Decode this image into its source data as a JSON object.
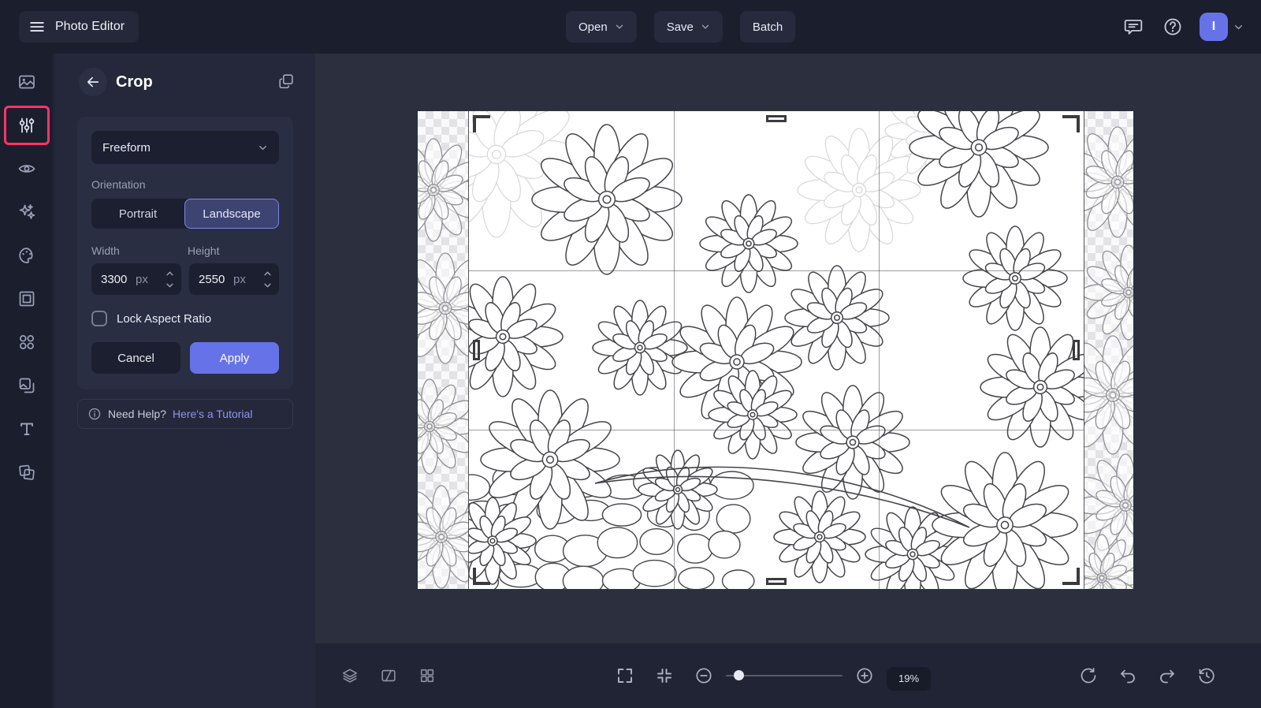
{
  "app": {
    "title": "Photo Editor"
  },
  "topbar": {
    "open": "Open",
    "save": "Save",
    "batch": "Batch",
    "icons": [
      "hamburger-icon",
      "chevron-down-icon",
      "feedback-icon",
      "help-icon"
    ],
    "avatar_initial": "I"
  },
  "sidebar": {
    "items": [
      {
        "id": "photo",
        "icon": "photo-icon",
        "selected": false
      },
      {
        "id": "edit",
        "icon": "sliders-icon",
        "selected": true,
        "highlighted": true
      },
      {
        "id": "touchup",
        "icon": "eye-icon",
        "selected": false
      },
      {
        "id": "effects",
        "icon": "sparkles-icon",
        "selected": false
      },
      {
        "id": "artsy",
        "icon": "palette-icon",
        "selected": false
      },
      {
        "id": "frames",
        "icon": "frame-icon",
        "selected": false
      },
      {
        "id": "overlays",
        "icon": "shapes-icon",
        "selected": false
      },
      {
        "id": "graphics",
        "icon": "graphics-icon",
        "selected": false
      },
      {
        "id": "text",
        "icon": "text-icon",
        "selected": false
      },
      {
        "id": "textures",
        "icon": "textures-icon",
        "selected": false
      }
    ],
    "highlight_color": "#fd3468"
  },
  "crop_panel": {
    "title": "Crop",
    "aspect": {
      "value": "Freeform"
    },
    "orientation": {
      "label": "Orientation",
      "options": [
        "Portrait",
        "Landscape"
      ],
      "selected": "Landscape"
    },
    "width": {
      "label": "Width",
      "value": "3300",
      "unit": "px"
    },
    "height": {
      "label": "Height",
      "value": "2550",
      "unit": "px"
    },
    "lock_aspect": {
      "label": "Lock Aspect Ratio",
      "checked": false
    },
    "cancel": "Cancel",
    "apply": "Apply",
    "help": {
      "text": "Need Help?",
      "link": "Here's a Tutorial"
    }
  },
  "bottom_toolbar": {
    "zoom": "19%",
    "icons": [
      "layers-icon",
      "compare-icon",
      "grid-icon",
      "fullscreen-icon",
      "fit-screen-icon",
      "zoom-out-icon",
      "zoom-in-icon",
      "reset-icon",
      "undo-icon",
      "redo-icon",
      "history-icon"
    ]
  },
  "colors": {
    "accent": "#6673e8",
    "link": "#8f94f3",
    "highlight": "#fd3468",
    "topbar_bg": "#1b1e2d",
    "panel_bg": "#24283a",
    "card_bg": "#2a2e42",
    "canvas_bg": "#2b2f3e",
    "bottombar_bg": "#212434"
  }
}
